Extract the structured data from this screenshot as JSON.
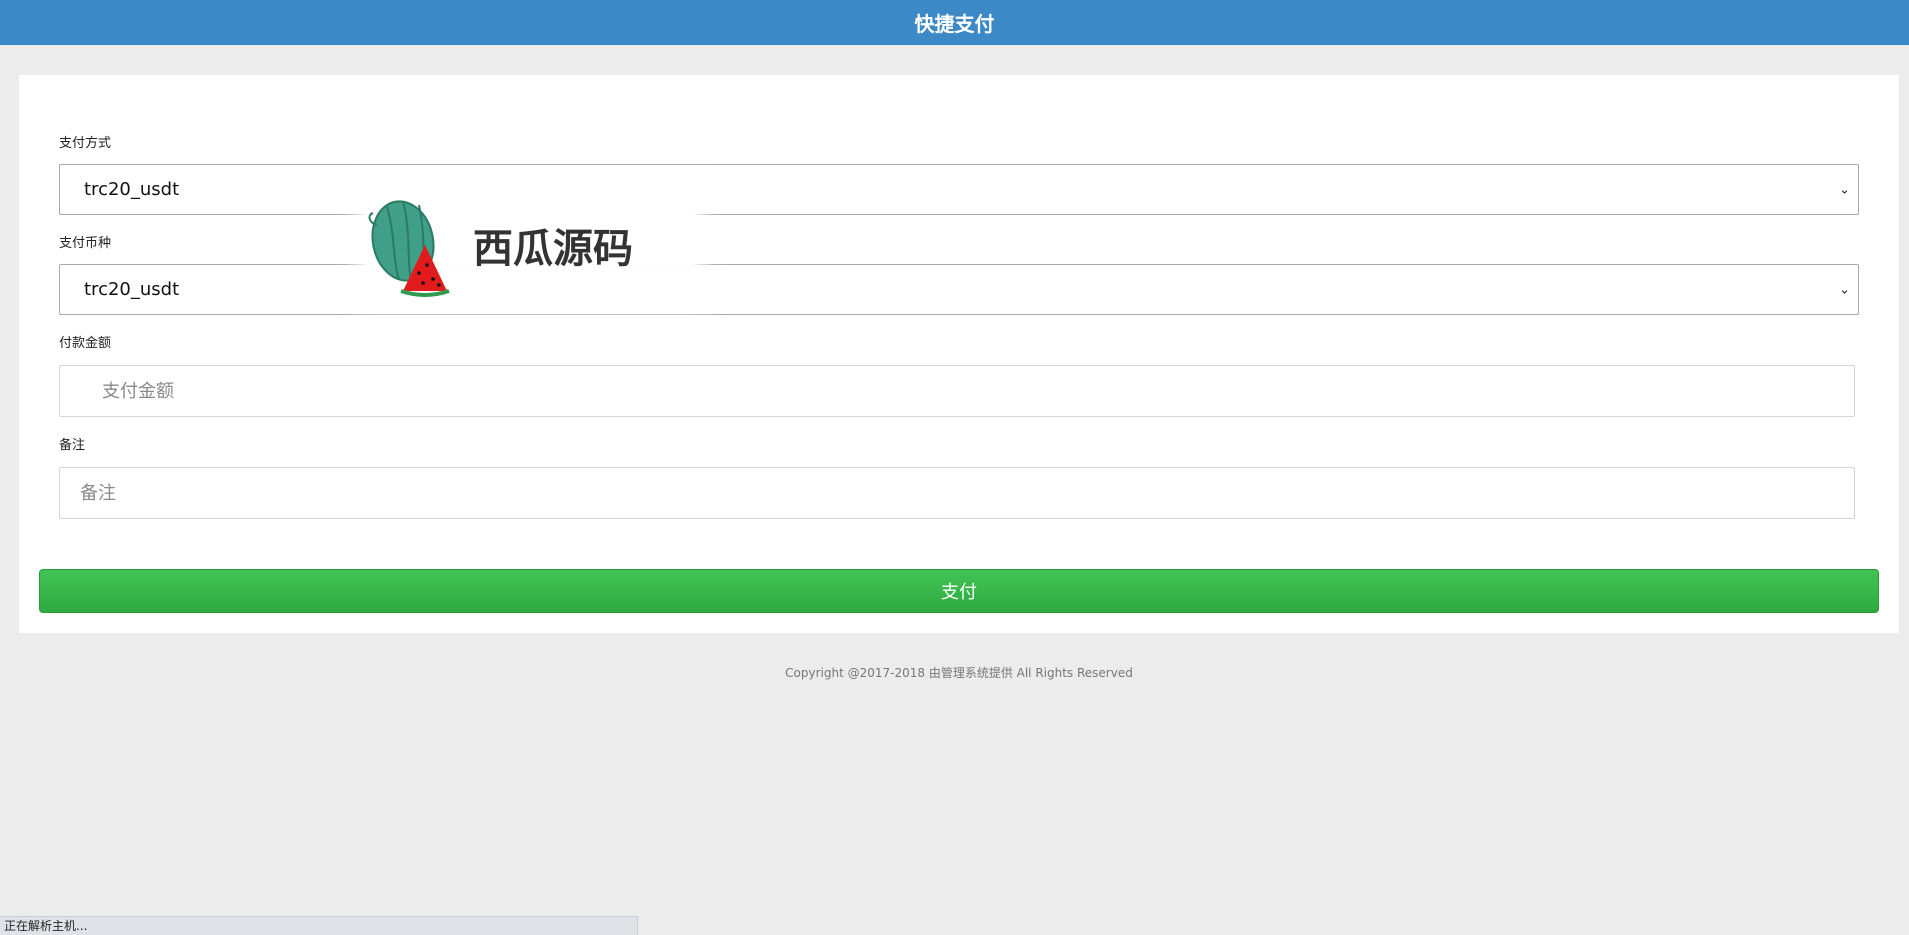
{
  "header": {
    "title": "快捷支付"
  },
  "form": {
    "pay_method": {
      "label": "支付方式",
      "selected": "trc20_usdt"
    },
    "pay_currency": {
      "label": "支付币种",
      "selected": "trc20_usdt"
    },
    "amount": {
      "label": "付款金额",
      "placeholder": "支付金额",
      "value": ""
    },
    "remark": {
      "label": "备注",
      "placeholder": "备注",
      "value": ""
    },
    "submit_label": "支付"
  },
  "footer": {
    "copyright": "Copyright @2017-2018 由管理系统提供 All Rights Reserved"
  },
  "watermark": {
    "text": "西瓜源码"
  },
  "statusbar": {
    "text": "正在解析主机..."
  },
  "colors": {
    "header_bg": "#3c89c6",
    "button_bg": "#38b84a",
    "page_bg": "#ececec"
  },
  "icons": {
    "select_arrow": "chevron-down-icon",
    "watermark_logo": "watermelon-icon"
  }
}
